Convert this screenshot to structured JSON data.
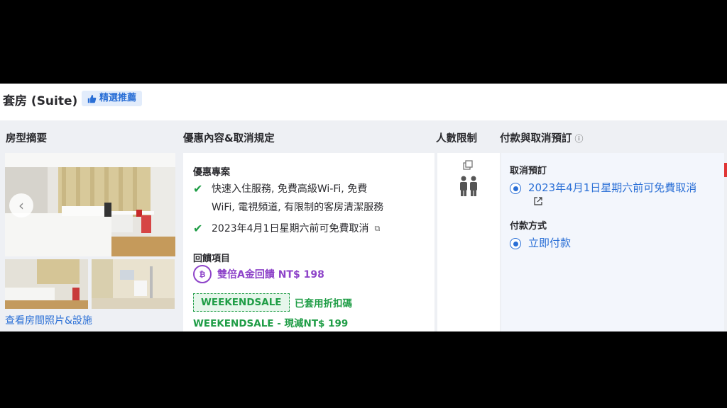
{
  "room": {
    "title": "套房 (Suite)",
    "badge_label": "精選推薦"
  },
  "columns": {
    "summary": "房型摘要",
    "offer": "優惠內容&取消規定",
    "occupancy": "人數限制",
    "payment": "付款與取消預訂"
  },
  "gallery": {
    "link_label": "查看房間照片&設施"
  },
  "offer": {
    "section_label": "優惠專案",
    "benefits": [
      "快速入住服務, 免費高級Wi-Fi, 免費",
      "WiFi, 電視頻道, 有限制的客房清潔服務",
      "2023年4月1日星期六前可免費取消"
    ],
    "rewards_label": "回饋項目",
    "coin_symbol": "₿",
    "reward_text": "雙倍A金回饋 NT$ 198",
    "promo_code": "WEEKENDSALE",
    "promo_applied": "已套用折扣碼",
    "promo_discount": "WEEKENDSALE - 現減NT$ 199"
  },
  "payment": {
    "cancel_label": "取消預訂",
    "cancel_option": "2023年4月1日星期六前可免費取消",
    "method_label": "付款方式",
    "method_option": "立即付款"
  },
  "colors": {
    "link_blue": "#2a6fd6",
    "success_green": "#1f9d46",
    "reward_purple": "#8e44c9",
    "badge_bg": "#e2ecfb"
  }
}
